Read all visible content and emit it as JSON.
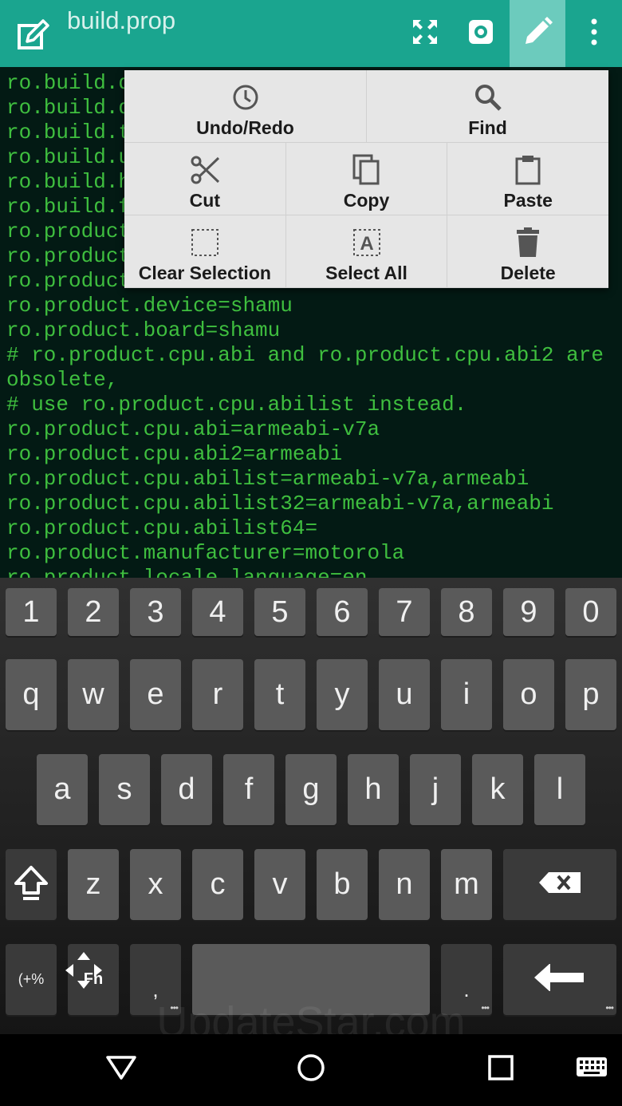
{
  "appbar": {
    "title": "build.prop",
    "icons": [
      "edit-note-icon",
      "fullscreen-icon",
      "settings-gear-icon",
      "pencil-edit-icon",
      "overflow-menu-icon"
    ],
    "accent": "#1aa58f",
    "active_bg": "#6ccbbd"
  },
  "editor": {
    "text_color": "#3fbf3f",
    "background": "#031a14",
    "lines": [
      "ro.build.d",
      "ro.build.d",
      "ro.build.t",
      "ro.build.u",
      "ro.build.h",
      "ro.build.f",
      "ro.product",
      "ro.product",
      "ro.product",
      "ro.product.device=shamu",
      "ro.product.board=shamu",
      "# ro.product.cpu.abi and ro.product.cpu.abi2 are",
      "obsolete,",
      "# use ro.product.cpu.abilist instead.",
      "ro.product.cpu.abi=armeabi-v7a",
      "ro.product.cpu.abi2=armeabi",
      "ro.product.cpu.abilist=armeabi-v7a,armeabi",
      "ro.product.cpu.abilist32=armeabi-v7a,armeabi",
      "ro.product.cpu.abilist64=",
      "ro.product.manufacturer=motorola",
      "ro.product.locale.language=en"
    ]
  },
  "popup": {
    "undo_redo": "Undo/Redo",
    "find": "Find",
    "cut": "Cut",
    "copy": "Copy",
    "paste": "Paste",
    "clear_selection": "Clear Selection",
    "select_all": "Select All",
    "select_all_glyph": "A",
    "delete": "Delete"
  },
  "keyboard": {
    "numbers": [
      "1",
      "2",
      "3",
      "4",
      "5",
      "6",
      "7",
      "8",
      "9",
      "0"
    ],
    "row1": [
      "q",
      "w",
      "e",
      "r",
      "t",
      "y",
      "u",
      "i",
      "o",
      "p"
    ],
    "row2": [
      "a",
      "s",
      "d",
      "f",
      "g",
      "h",
      "j",
      "k",
      "l"
    ],
    "row3": [
      "z",
      "x",
      "c",
      "v",
      "b",
      "n",
      "m"
    ],
    "symbols_key": "(+%",
    "fn_key": "Fn",
    "comma": ",",
    "period": ".",
    "dots": "•••"
  },
  "watermark": "UpdateStar.com",
  "navbar": {
    "icons": [
      "back-triangle-icon",
      "home-circle-icon",
      "recents-square-icon",
      "keyboard-icon"
    ]
  }
}
